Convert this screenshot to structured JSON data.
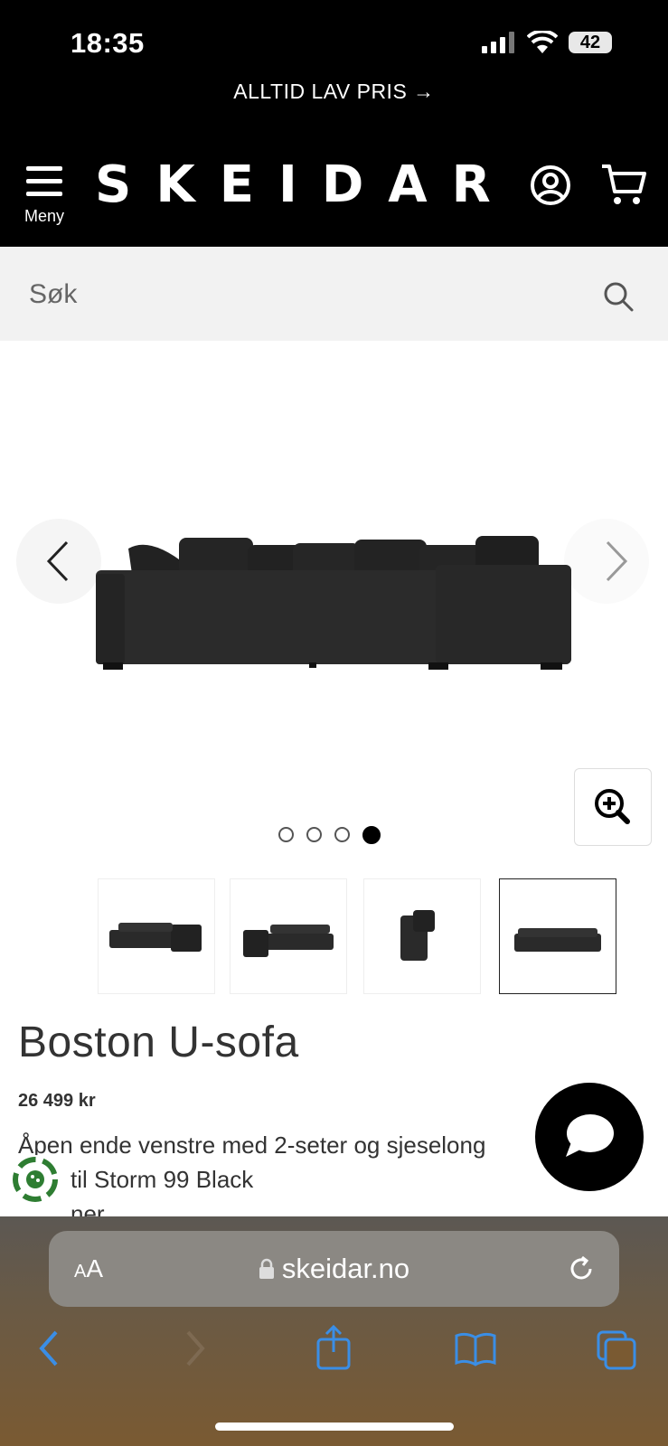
{
  "status_bar": {
    "time": "18:35",
    "battery": "42"
  },
  "promo": {
    "text": "ALLTID LAV PRIS →"
  },
  "header": {
    "menu_label": "Meny",
    "logo": "SKEIDAR"
  },
  "search": {
    "placeholder": "Søk"
  },
  "carousel": {
    "dots": 4,
    "active_index": 3
  },
  "product": {
    "title": "Boston U-sofa",
    "price": "26 499 kr",
    "description_line1": "Åpen ende venstre med 2-seter og sjeselong",
    "description_line2": "til Storm 99 Black",
    "description_line3": "ner"
  },
  "browser": {
    "aa_small": "A",
    "aa_big": "A",
    "url": "skeidar.no"
  },
  "colors": {
    "header_bg": "#000000",
    "search_bg": "#f2f2f2",
    "safari_blue": "#3a8ee6",
    "badge_green": "#2e7d32"
  }
}
